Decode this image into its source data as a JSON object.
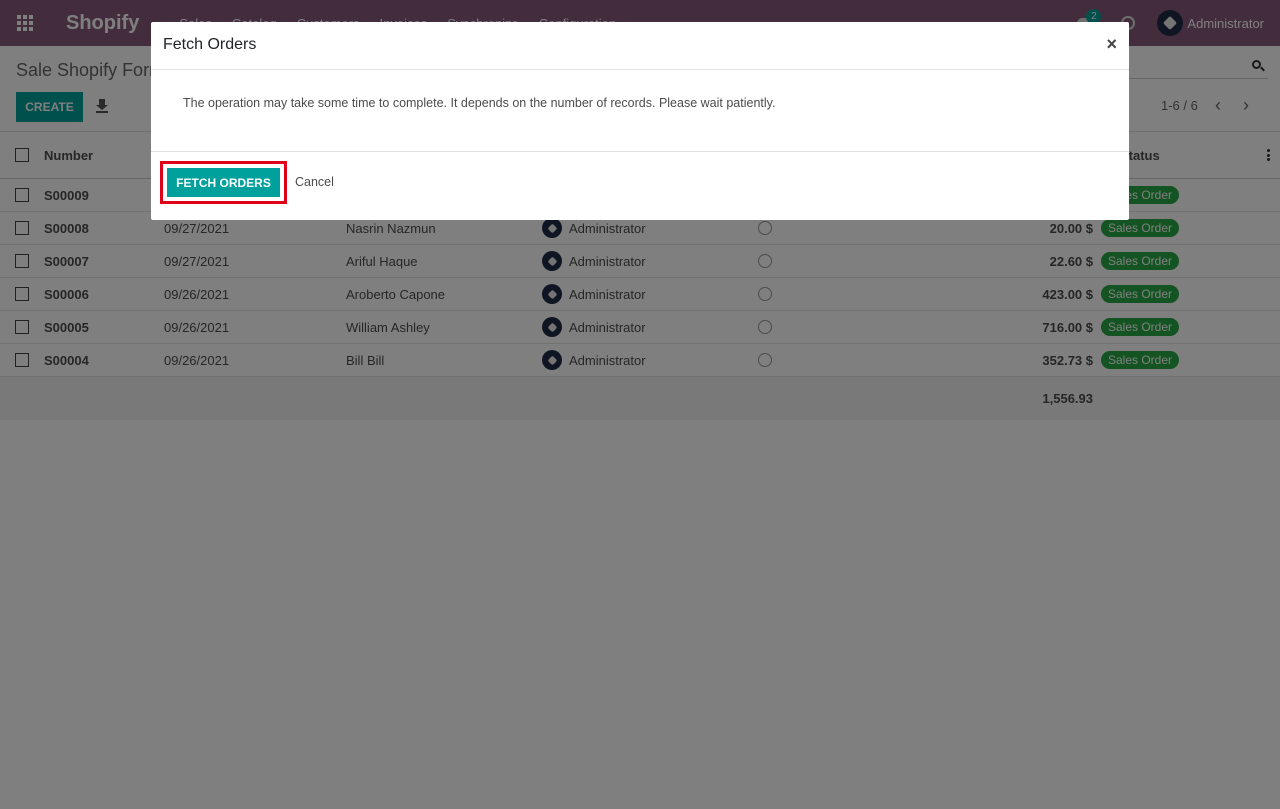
{
  "navbar": {
    "brand": "Shopify",
    "menu": [
      "Sales",
      "Catalog",
      "Customers",
      "Invoices",
      "Synchronize",
      "Configuration"
    ],
    "chat_badge": "2",
    "user": "Administrator"
  },
  "control": {
    "breadcrumb": "Sale Shopify Form",
    "create_label": "CREATE",
    "pager": "1-6 / 6",
    "pager_prev": "‹",
    "pager_next": "›"
  },
  "table": {
    "headers": {
      "number": "Number",
      "status": "Status"
    },
    "rows": [
      {
        "number": "S00009",
        "date": "",
        "customer": "",
        "salesperson": "",
        "total": "",
        "status": "Sales Order"
      },
      {
        "number": "S00008",
        "date": "09/27/2021",
        "customer": "Nasrin Nazmun",
        "salesperson": "Administrator",
        "total": "20.00 $",
        "status": "Sales Order"
      },
      {
        "number": "S00007",
        "date": "09/27/2021",
        "customer": "Ariful Haque",
        "salesperson": "Administrator",
        "total": "22.60 $",
        "status": "Sales Order"
      },
      {
        "number": "S00006",
        "date": "09/26/2021",
        "customer": "Aroberto Capone",
        "salesperson": "Administrator",
        "total": "423.00 $",
        "status": "Sales Order"
      },
      {
        "number": "S00005",
        "date": "09/26/2021",
        "customer": "William Ashley",
        "salesperson": "Administrator",
        "total": "716.00 $",
        "status": "Sales Order"
      },
      {
        "number": "S00004",
        "date": "09/26/2021",
        "customer": "Bill Bill",
        "salesperson": "Administrator",
        "total": "352.73 $",
        "status": "Sales Order"
      }
    ],
    "grand_total": "1,556.93"
  },
  "modal": {
    "title": "Fetch Orders",
    "close": "×",
    "message": "The operation may take some time to complete. It depends on the number of records. Please wait patiently.",
    "primary_label": "FETCH ORDERS",
    "cancel_label": "Cancel"
  },
  "colors": {
    "navbar": "#875a7b",
    "primary": "#00a09d",
    "status_tag": "#28a745",
    "highlight": "#e0001a"
  }
}
